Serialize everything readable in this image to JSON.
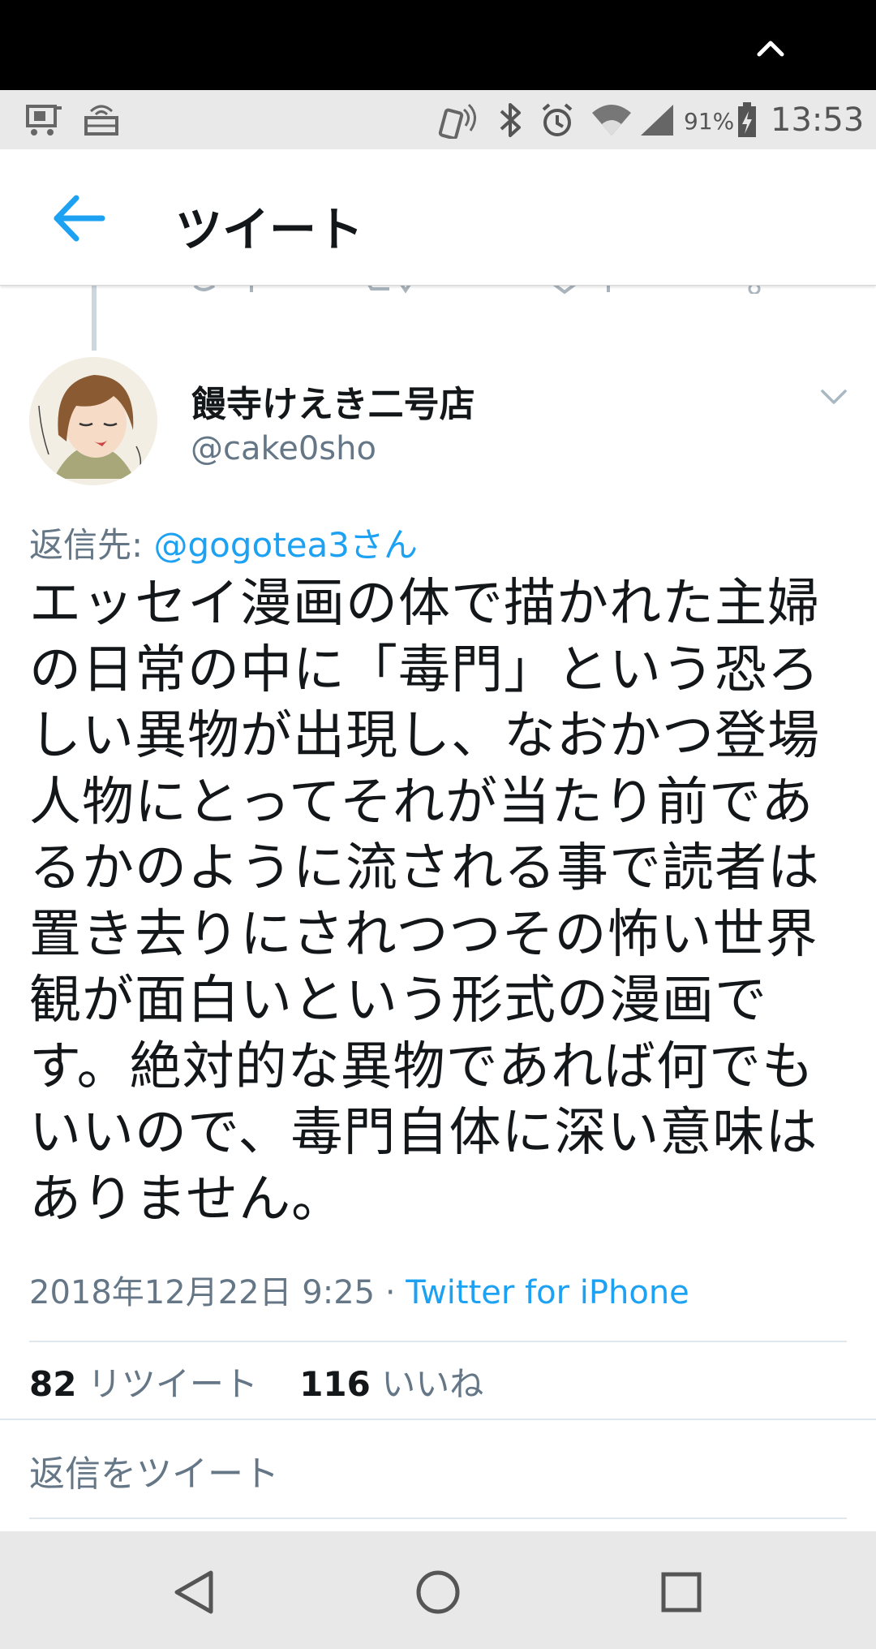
{
  "status_bar": {
    "battery_percent": "91%",
    "time": "13:53"
  },
  "header": {
    "title": "ツイート"
  },
  "tweet": {
    "display_name": "饅寺けえき二号店",
    "handle": "@cake0sho",
    "reply_prefix": "返信先: ",
    "reply_mention": "@gogotea3さん",
    "text": "エッセイ漫画の体で描かれた主婦の日常の中に「毒門」という恐ろしい異物が出現し、なおかつ登場人物にとってそれが当たり前であるかのように流される事で読者は置き去りにされつつその怖い世界観が面白いという形式の漫画です。絶対的な異物であれば何でもいいので、毒門自体に深い意味はありません。",
    "timestamp": "2018年12月22日 9:25 · ",
    "client": "Twitter for iPhone",
    "retweet_count": "82",
    "retweet_label": "リツイート",
    "like_count": "116",
    "like_label": "いいね"
  },
  "reply_placeholder": "返信をツイート",
  "icons": {
    "back": "arrow-left-icon",
    "caret": "chevron-down-icon",
    "nav_back": "triangle-back-icon",
    "nav_home": "circle-home-icon",
    "nav_recents": "square-recents-icon"
  },
  "colors": {
    "accent": "#1da1f2",
    "secondary_text": "#657786",
    "primary_text": "#14171a"
  }
}
